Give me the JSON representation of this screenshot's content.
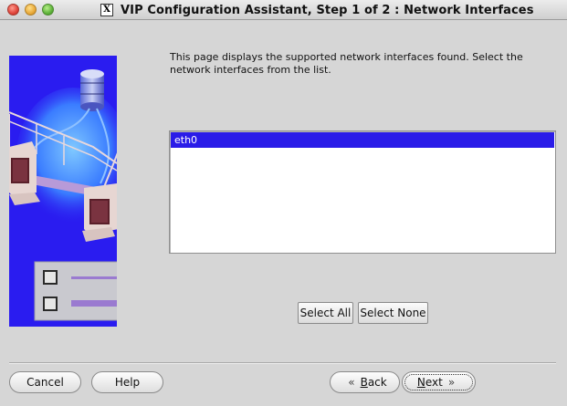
{
  "window": {
    "title": "VIP Configuration Assistant, Step 1 of 2 : Network Interfaces",
    "icon": "x11-icon",
    "app_glyph": "X"
  },
  "content": {
    "description": "This page displays the supported network interfaces found. Select the network interfaces from the list.",
    "interfaces": [
      "eth0"
    ],
    "selected_interface": "eth0"
  },
  "buttons": {
    "select_all": "Select All",
    "select_none": "Select None",
    "cancel": "Cancel",
    "help": "Help",
    "back_mnemonic": "B",
    "back_rest": "ack",
    "next_mnemonic": "N",
    "next_rest": "ext"
  },
  "colors": {
    "selection": "#2a1ce8",
    "illustration_bg": "#2a1cf0",
    "window_bg": "#d6d6d6"
  }
}
